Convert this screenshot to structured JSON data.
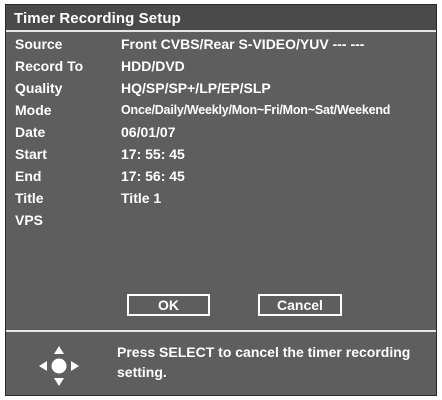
{
  "window": {
    "title": "Timer Recording Setup"
  },
  "settings": [
    {
      "label": "Source",
      "value": "Front CVBS/Rear S-VIDEO/YUV --- ---"
    },
    {
      "label": "Record To",
      "value": "HDD/DVD"
    },
    {
      "label": "Quality",
      "value": "HQ/SP/SP+/LP/EP/SLP"
    },
    {
      "label": "Mode",
      "value": "Once/Daily/Weekly/Mon~Fri/Mon~Sat/Weekend"
    },
    {
      "label": "Date",
      "value": "06/01/07"
    },
    {
      "label": "Start",
      "value": "17: 55: 45"
    },
    {
      "label": "End",
      "value": "17: 56: 45"
    },
    {
      "label": "Title",
      "value": "Title 1"
    },
    {
      "label": "VPS",
      "value": ""
    }
  ],
  "buttons": {
    "ok_label": "OK",
    "cancel_label": "Cancel"
  },
  "help": {
    "icon": "directional-pad-icon",
    "text": "Press SELECT to cancel the timer recording setting."
  },
  "colors": {
    "panel_background": "#5e5e5e",
    "title_background": "#4a4a4a",
    "text": "#ffffff",
    "divider": "#e6e6e6"
  }
}
